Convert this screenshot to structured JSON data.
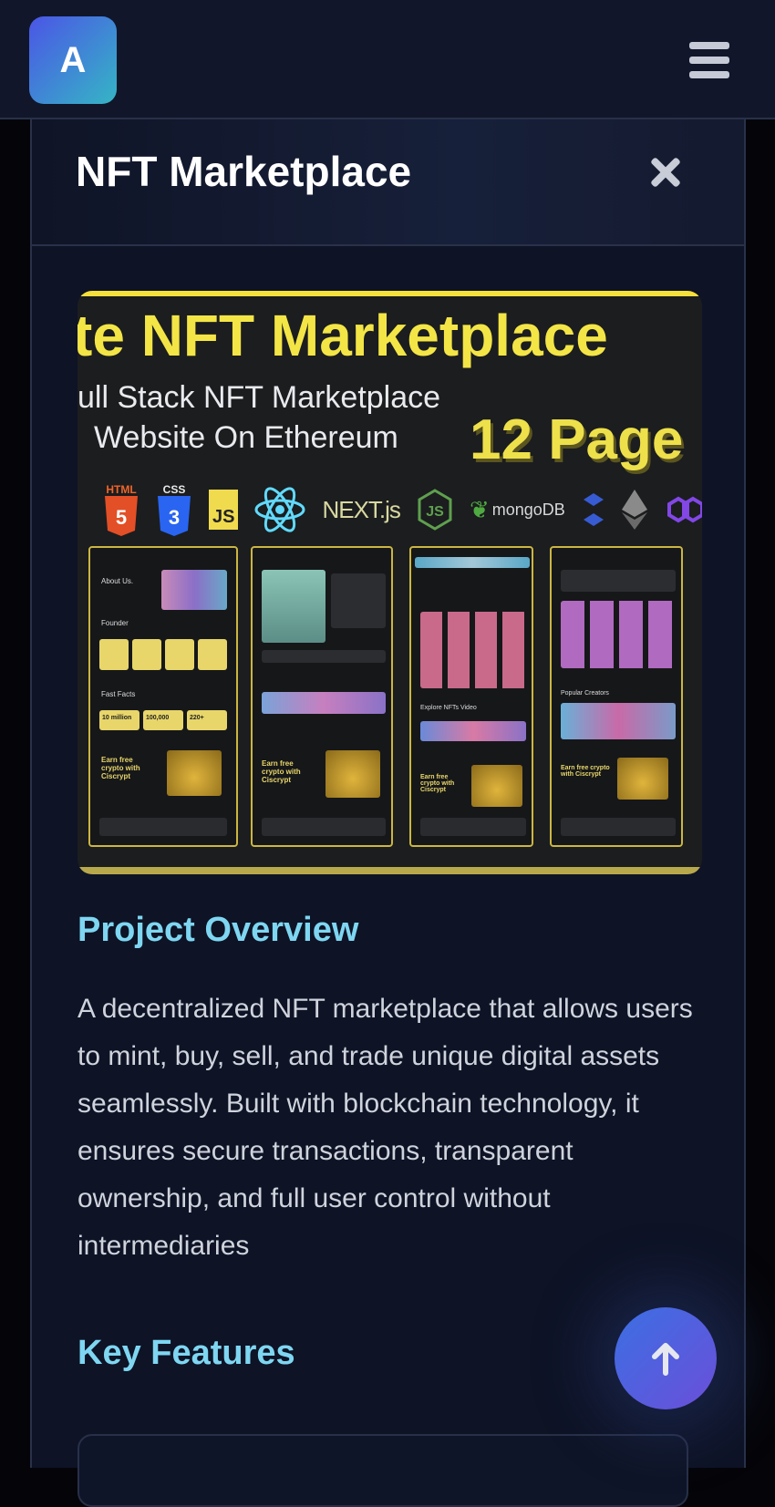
{
  "header": {
    "logo_letter": "A",
    "menu_icon": "hamburger-menu-icon"
  },
  "modal": {
    "title": "NFT Marketplace",
    "close_icon": "close-icon"
  },
  "hero_image": {
    "headline": "te NFT Marketplace",
    "subtitle_line1": "ull Stack NFT Marketplace",
    "subtitle_line2": "Website On Ethereum",
    "pages_badge": "12 Page",
    "tech": [
      "HTML",
      "CSS",
      "JS",
      "React",
      "NEXT.js",
      "Node.js",
      "mongoDB",
      "Chainlink",
      "Ethereum",
      "Polygon"
    ],
    "mockup_texts": {
      "about": "About Us.",
      "founder": "Founder",
      "fast_facts": "Fast Facts",
      "fact_1": "10 million",
      "fact_2": "100,000",
      "fact_3": "220+",
      "earn": "Earn free crypto with Ciscrypt",
      "explore": "Explore NFTs Video",
      "creators": "Popular Creators"
    }
  },
  "overview": {
    "heading": "Project Overview",
    "body": "A decentralized NFT marketplace that allows users to mint, buy, sell, and trade unique digital assets seamlessly. Built with blockchain technology, it ensures secure transactions, transparent ownership, and full user control without intermediaries"
  },
  "features": {
    "heading": "Key Features"
  },
  "scroll_top": {
    "icon": "arrow-up-icon"
  },
  "colors": {
    "accent_cyan": "#7ed6f1",
    "hero_yellow": "#f3e546",
    "button_gradient_start": "#3b6fe3",
    "button_gradient_end": "#6b4fd9"
  }
}
